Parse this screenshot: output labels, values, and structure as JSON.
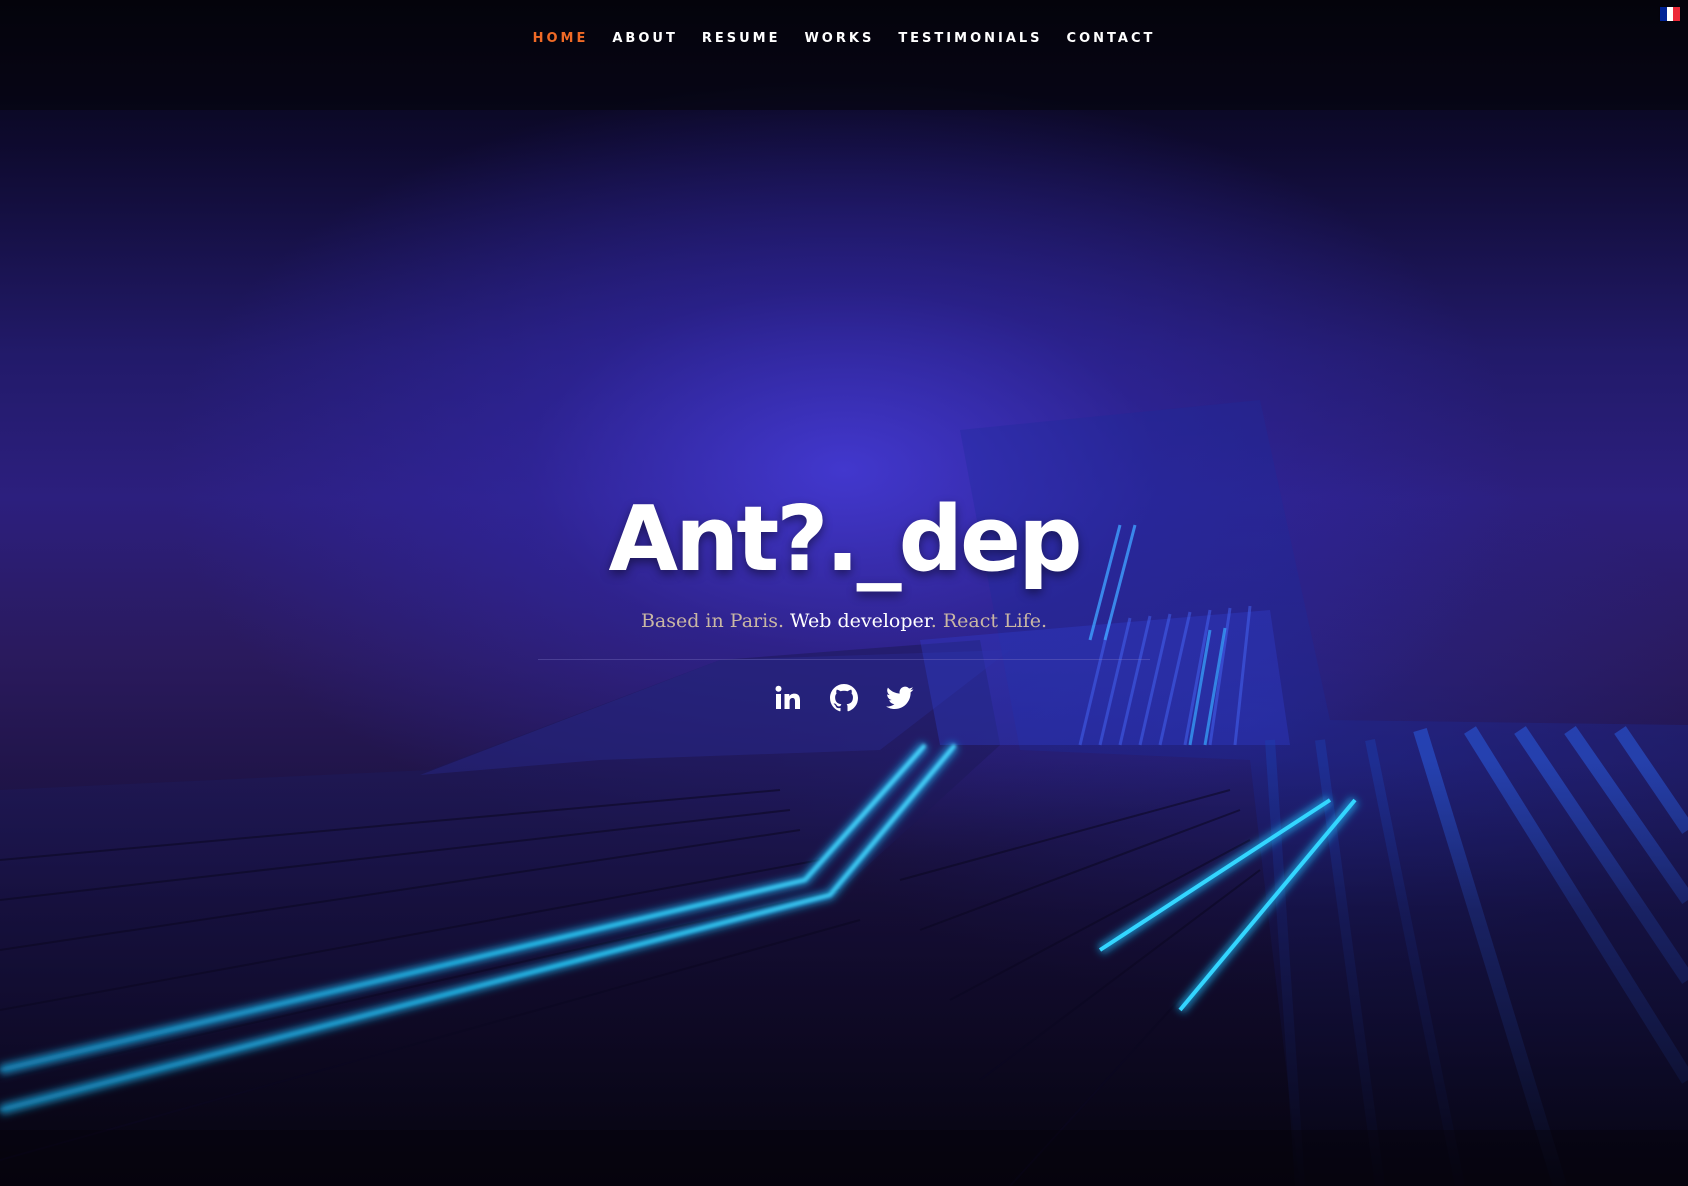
{
  "nav": {
    "items": [
      {
        "label": "HOME",
        "active": true
      },
      {
        "label": "ABOUT",
        "active": false
      },
      {
        "label": "RESUME",
        "active": false
      },
      {
        "label": "WORKS",
        "active": false
      },
      {
        "label": "TESTIMONIALS",
        "active": false
      },
      {
        "label": "CONTACT",
        "active": false
      }
    ],
    "active_color": "#f06a26",
    "text_color": "#ffffff"
  },
  "language": {
    "icon": "french-flag-icon",
    "colors": [
      "#002395",
      "#ffffff",
      "#ed2939"
    ]
  },
  "hero": {
    "title": "Ant?._dep",
    "tagline": {
      "part1": "Based in Paris. ",
      "highlight": "Web developer",
      "part2": ". React Life."
    },
    "tagline_color": "#c9b7a4",
    "highlight_color": "#ffffff"
  },
  "social": [
    {
      "icon": "linkedin-icon"
    },
    {
      "icon": "github-icon"
    },
    {
      "icon": "twitter-icon"
    }
  ]
}
